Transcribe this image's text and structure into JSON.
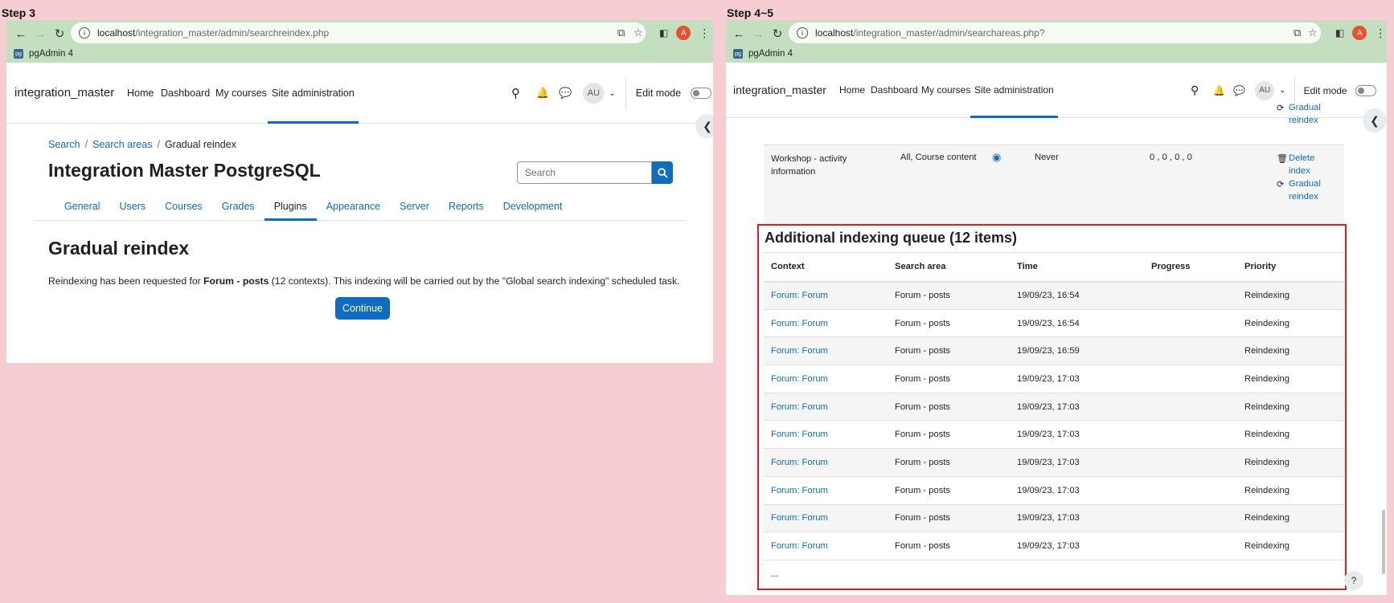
{
  "left": {
    "step_label": "Step 3",
    "url_host": "localhost",
    "url_path": "/integration_master/admin/searchreindex.php",
    "bookmark": "pgAdmin 4",
    "profile_initial": "A",
    "brand": "integration_master",
    "nav": [
      "Home",
      "Dashboard",
      "My courses",
      "Site administration"
    ],
    "avatar": "AU",
    "edit_mode": "Edit mode",
    "breadcrumb": [
      "Search",
      "Search areas",
      "Gradual reindex"
    ],
    "page_title": "Integration Master PostgreSQL",
    "search_placeholder": "Search",
    "tabs": [
      "General",
      "Users",
      "Courses",
      "Grades",
      "Plugins",
      "Appearance",
      "Server",
      "Reports",
      "Development"
    ],
    "active_tab": "Plugins",
    "heading": "Gradual reindex",
    "message_pre": "Reindexing has been requested for ",
    "message_bold": "Forum - posts",
    "message_post": " (12 contexts). This indexing will be carried out by the \"Global search indexing\" scheduled task.",
    "continue": "Continue"
  },
  "right": {
    "step_label": "Step 4~5",
    "url_host": "localhost",
    "url_path": "/integration_master/admin/searchareas.php?",
    "bookmark": "pgAdmin 4",
    "profile_initial": "A",
    "brand": "integration_master",
    "nav": [
      "Home",
      "Dashboard",
      "My courses",
      "Site administration"
    ],
    "avatar": "AU",
    "edit_mode": "Edit mode",
    "prev_action_line1": "Gradual",
    "prev_action_line2": "reindex",
    "workshop": {
      "name_line1": "Workshop - activity",
      "name_line2": "information",
      "categories": "All, Course content",
      "last_indexed": "Never",
      "stats": "0 , 0 , 0 , 0",
      "delete_line1": "Delete",
      "delete_line2": "index",
      "reindex_line1": "Gradual",
      "reindex_line2": "reindex"
    },
    "queue_title": "Additional indexing queue (12 items)",
    "columns": [
      "Context",
      "Search area",
      "Time",
      "Progress",
      "Priority"
    ],
    "rows": [
      [
        "Forum: Forum",
        "Forum - posts",
        "19/09/23, 16:54",
        "",
        "Reindexing"
      ],
      [
        "Forum: Forum",
        "Forum - posts",
        "19/09/23, 16:54",
        "",
        "Reindexing"
      ],
      [
        "Forum: Forum",
        "Forum - posts",
        "19/09/23, 16:59",
        "",
        "Reindexing"
      ],
      [
        "Forum: Forum",
        "Forum - posts",
        "19/09/23, 17:03",
        "",
        "Reindexing"
      ],
      [
        "Forum: Forum",
        "Forum - posts",
        "19/09/23, 17:03",
        "",
        "Reindexing"
      ],
      [
        "Forum: Forum",
        "Forum - posts",
        "19/09/23, 17:03",
        "",
        "Reindexing"
      ],
      [
        "Forum: Forum",
        "Forum - posts",
        "19/09/23, 17:03",
        "",
        "Reindexing"
      ],
      [
        "Forum: Forum",
        "Forum - posts",
        "19/09/23, 17:03",
        "",
        "Reindexing"
      ],
      [
        "Forum: Forum",
        "Forum - posts",
        "19/09/23, 17:03",
        "",
        "Reindexing"
      ],
      [
        "Forum: Forum",
        "Forum - posts",
        "19/09/23, 17:03",
        "",
        "Reindexing"
      ]
    ],
    "ellipsis": "...",
    "help": "?"
  },
  "colors": {
    "accent": "#0f6cbf",
    "highlight": "#e31b23",
    "chrome": "#c4dfbf",
    "background": "#f6cdd3"
  }
}
